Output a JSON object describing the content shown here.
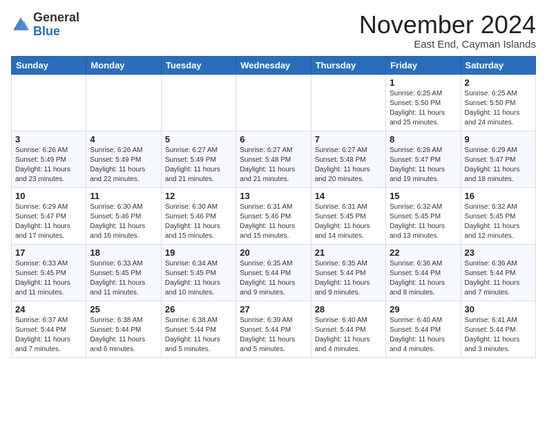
{
  "header": {
    "logo_general": "General",
    "logo_blue": "Blue",
    "month_title": "November 2024",
    "location": "East End, Cayman Islands"
  },
  "days_of_week": [
    "Sunday",
    "Monday",
    "Tuesday",
    "Wednesday",
    "Thursday",
    "Friday",
    "Saturday"
  ],
  "weeks": [
    [
      {
        "day": "",
        "info": ""
      },
      {
        "day": "",
        "info": ""
      },
      {
        "day": "",
        "info": ""
      },
      {
        "day": "",
        "info": ""
      },
      {
        "day": "",
        "info": ""
      },
      {
        "day": "1",
        "info": "Sunrise: 6:25 AM\nSunset: 5:50 PM\nDaylight: 11 hours and 25 minutes."
      },
      {
        "day": "2",
        "info": "Sunrise: 6:25 AM\nSunset: 5:50 PM\nDaylight: 11 hours and 24 minutes."
      }
    ],
    [
      {
        "day": "3",
        "info": "Sunrise: 6:26 AM\nSunset: 5:49 PM\nDaylight: 11 hours and 23 minutes."
      },
      {
        "day": "4",
        "info": "Sunrise: 6:26 AM\nSunset: 5:49 PM\nDaylight: 11 hours and 22 minutes."
      },
      {
        "day": "5",
        "info": "Sunrise: 6:27 AM\nSunset: 5:49 PM\nDaylight: 11 hours and 21 minutes."
      },
      {
        "day": "6",
        "info": "Sunrise: 6:27 AM\nSunset: 5:48 PM\nDaylight: 11 hours and 21 minutes."
      },
      {
        "day": "7",
        "info": "Sunrise: 6:27 AM\nSunset: 5:48 PM\nDaylight: 11 hours and 20 minutes."
      },
      {
        "day": "8",
        "info": "Sunrise: 6:28 AM\nSunset: 5:47 PM\nDaylight: 11 hours and 19 minutes."
      },
      {
        "day": "9",
        "info": "Sunrise: 6:29 AM\nSunset: 5:47 PM\nDaylight: 11 hours and 18 minutes."
      }
    ],
    [
      {
        "day": "10",
        "info": "Sunrise: 6:29 AM\nSunset: 5:47 PM\nDaylight: 11 hours and 17 minutes."
      },
      {
        "day": "11",
        "info": "Sunrise: 6:30 AM\nSunset: 5:46 PM\nDaylight: 11 hours and 16 minutes."
      },
      {
        "day": "12",
        "info": "Sunrise: 6:30 AM\nSunset: 5:46 PM\nDaylight: 11 hours and 15 minutes."
      },
      {
        "day": "13",
        "info": "Sunrise: 6:31 AM\nSunset: 5:46 PM\nDaylight: 11 hours and 15 minutes."
      },
      {
        "day": "14",
        "info": "Sunrise: 6:31 AM\nSunset: 5:45 PM\nDaylight: 11 hours and 14 minutes."
      },
      {
        "day": "15",
        "info": "Sunrise: 6:32 AM\nSunset: 5:45 PM\nDaylight: 11 hours and 13 minutes."
      },
      {
        "day": "16",
        "info": "Sunrise: 6:32 AM\nSunset: 5:45 PM\nDaylight: 11 hours and 12 minutes."
      }
    ],
    [
      {
        "day": "17",
        "info": "Sunrise: 6:33 AM\nSunset: 5:45 PM\nDaylight: 11 hours and 11 minutes."
      },
      {
        "day": "18",
        "info": "Sunrise: 6:33 AM\nSunset: 5:45 PM\nDaylight: 11 hours and 11 minutes."
      },
      {
        "day": "19",
        "info": "Sunrise: 6:34 AM\nSunset: 5:45 PM\nDaylight: 11 hours and 10 minutes."
      },
      {
        "day": "20",
        "info": "Sunrise: 6:35 AM\nSunset: 5:44 PM\nDaylight: 11 hours and 9 minutes."
      },
      {
        "day": "21",
        "info": "Sunrise: 6:35 AM\nSunset: 5:44 PM\nDaylight: 11 hours and 9 minutes."
      },
      {
        "day": "22",
        "info": "Sunrise: 6:36 AM\nSunset: 5:44 PM\nDaylight: 11 hours and 8 minutes."
      },
      {
        "day": "23",
        "info": "Sunrise: 6:36 AM\nSunset: 5:44 PM\nDaylight: 11 hours and 7 minutes."
      }
    ],
    [
      {
        "day": "24",
        "info": "Sunrise: 6:37 AM\nSunset: 5:44 PM\nDaylight: 11 hours and 7 minutes."
      },
      {
        "day": "25",
        "info": "Sunrise: 6:38 AM\nSunset: 5:44 PM\nDaylight: 11 hours and 6 minutes."
      },
      {
        "day": "26",
        "info": "Sunrise: 6:38 AM\nSunset: 5:44 PM\nDaylight: 11 hours and 5 minutes."
      },
      {
        "day": "27",
        "info": "Sunrise: 6:39 AM\nSunset: 5:44 PM\nDaylight: 11 hours and 5 minutes."
      },
      {
        "day": "28",
        "info": "Sunrise: 6:40 AM\nSunset: 5:44 PM\nDaylight: 11 hours and 4 minutes."
      },
      {
        "day": "29",
        "info": "Sunrise: 6:40 AM\nSunset: 5:44 PM\nDaylight: 11 hours and 4 minutes."
      },
      {
        "day": "30",
        "info": "Sunrise: 6:41 AM\nSunset: 5:44 PM\nDaylight: 11 hours and 3 minutes."
      }
    ]
  ]
}
